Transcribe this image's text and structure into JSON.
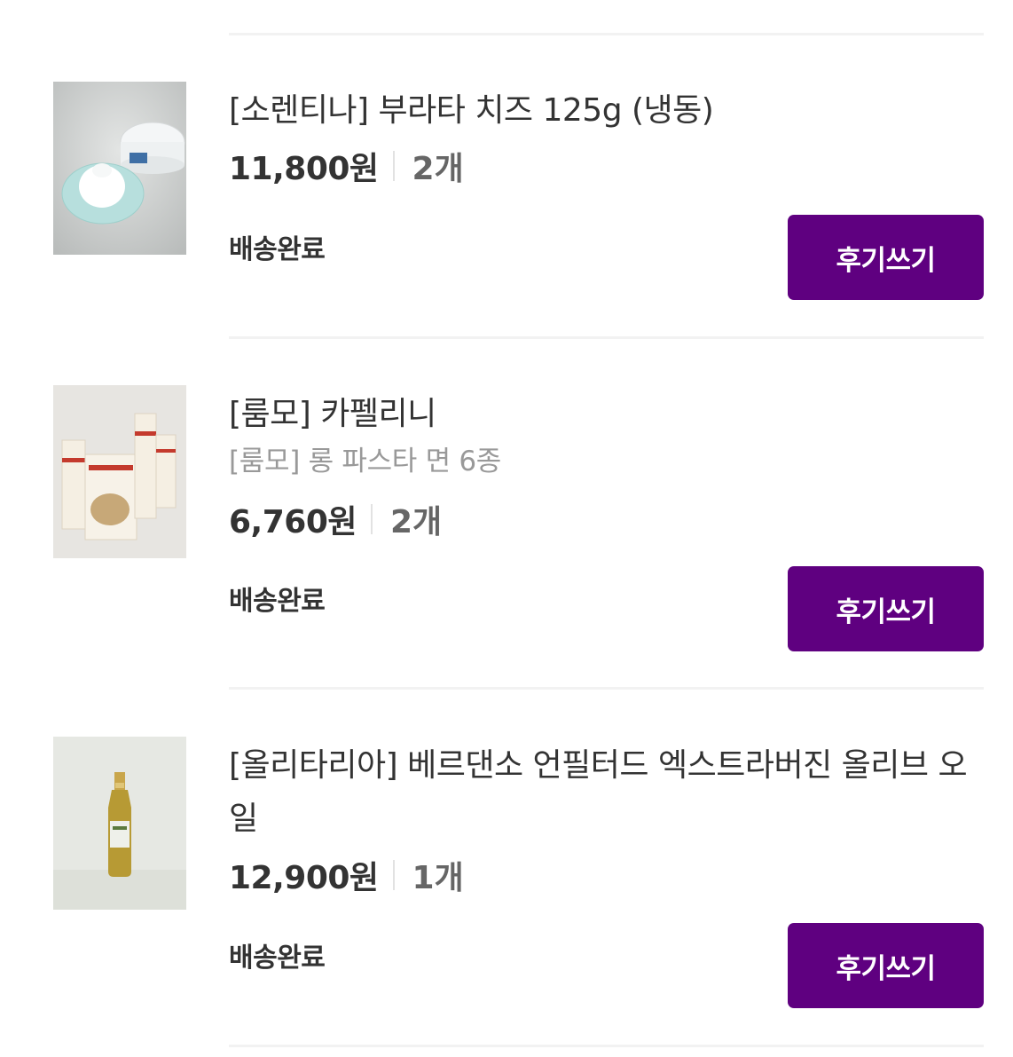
{
  "colors": {
    "accent": "#5f0080",
    "divider": "#f2f2f2",
    "text": "#333333",
    "subtext": "#999999"
  },
  "items": [
    {
      "title": "[소렌티나] 부라타 치즈 125g (냉동)",
      "subtitle": "",
      "price": "11,800원",
      "quantity": "2개",
      "status": "배송완료",
      "review_button": "후기쓰기",
      "image_alt": "burrata-cheese-image"
    },
    {
      "title": "[룸모] 카펠리니",
      "subtitle": "[룸모] 롱 파스타 면 6종",
      "price": "6,760원",
      "quantity": "2개",
      "status": "배송완료",
      "review_button": "후기쓰기",
      "image_alt": "rummo-pasta-image"
    },
    {
      "title": "[올리타리아] 베르댄소 언필터드 엑스트라버진 올리브 오일",
      "subtitle": "",
      "price": "12,900원",
      "quantity": "1개",
      "status": "배송완료",
      "review_button": "후기쓰기",
      "image_alt": "olive-oil-image"
    }
  ]
}
